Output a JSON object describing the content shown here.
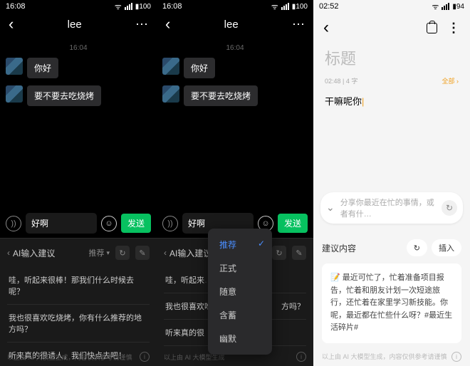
{
  "s1": {
    "time": "16:08",
    "battery": "100",
    "title": "lee",
    "msg_time": "16:04",
    "msgs": [
      "你好",
      "要不要去吃烧烤"
    ],
    "input_value": "好啊",
    "send": "发送",
    "ai_title": "AI输入建议",
    "mode": "推荐",
    "suggestions": [
      "哇，听起来很棒！那我们什么时候去呢？",
      "我也很喜欢吃烧烤，你有什么推荐的地方吗？",
      "听来真的很诱人，我们快点去吧！"
    ],
    "footer": "以上由 AI 大模型生成，内容仅供参考请谨慎"
  },
  "s2": {
    "time": "16:08",
    "battery": "100",
    "title": "lee",
    "msg_time": "16:04",
    "msgs": [
      "你好",
      "要不要去吃烧烤"
    ],
    "input_value": "好啊",
    "send": "发送",
    "ai_title": "AI输入建议",
    "mode": "推荐",
    "sugg_a": "哇，听起来",
    "sugg_b": "我也很喜欢吃",
    "sugg_b_tail": "方吗？",
    "sugg_c": "听来真的很",
    "dropdown": [
      "推荐",
      "正式",
      "随意",
      "含蓄",
      "幽默"
    ],
    "footer": "以上由 AI 大模型生成"
  },
  "s3": {
    "time": "02:52",
    "battery": "94",
    "title_ph": "标题",
    "meta_time": "02:48",
    "meta_count": "4 字",
    "meta_cat": "全部 ›",
    "body_text": "干嘛呢你",
    "ai_ph": "分享你最近在忙的事情，或者有什…",
    "s2_title": "建议内容",
    "insert": "插入",
    "card": "📝 最近可忙了，忙着准备项目报告，忙着和朋友计划一次短途旅行，还忙着在家里学习新技能。你呢，最近都在忙些什么呀？#最近生活碎片#",
    "footer": "以上由 AI 大模型生成，内容仅供参考请谨慎"
  }
}
